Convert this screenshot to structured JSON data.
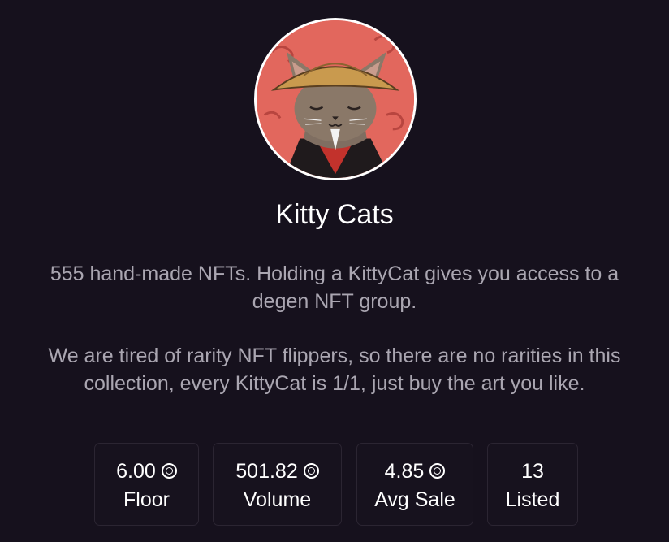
{
  "collection": {
    "name": "Kitty Cats",
    "avatar_icon": "kitty-cat-samurai-avatar",
    "description": [
      "555 hand-made NFTs. Holding a KittyCat gives you access to a degen NFT group.",
      "We are tired of rarity NFT flippers, so there are no rarities in this collection, every KittyCat is 1/1, just buy the art you like."
    ]
  },
  "stats": [
    {
      "value": "6.00",
      "label": "Floor",
      "icon": "sol-icon"
    },
    {
      "value": "501.82",
      "label": "Volume",
      "icon": "sol-icon"
    },
    {
      "value": "4.85",
      "label": "Avg Sale",
      "icon": "sol-icon"
    },
    {
      "value": "13",
      "label": "Listed",
      "icon": ""
    }
  ],
  "colors": {
    "background": "#16111d",
    "text_primary": "#ffffff",
    "text_secondary": "#aaa6b1",
    "card_border": "#2b2532",
    "avatar_bg": "#e2675d"
  }
}
